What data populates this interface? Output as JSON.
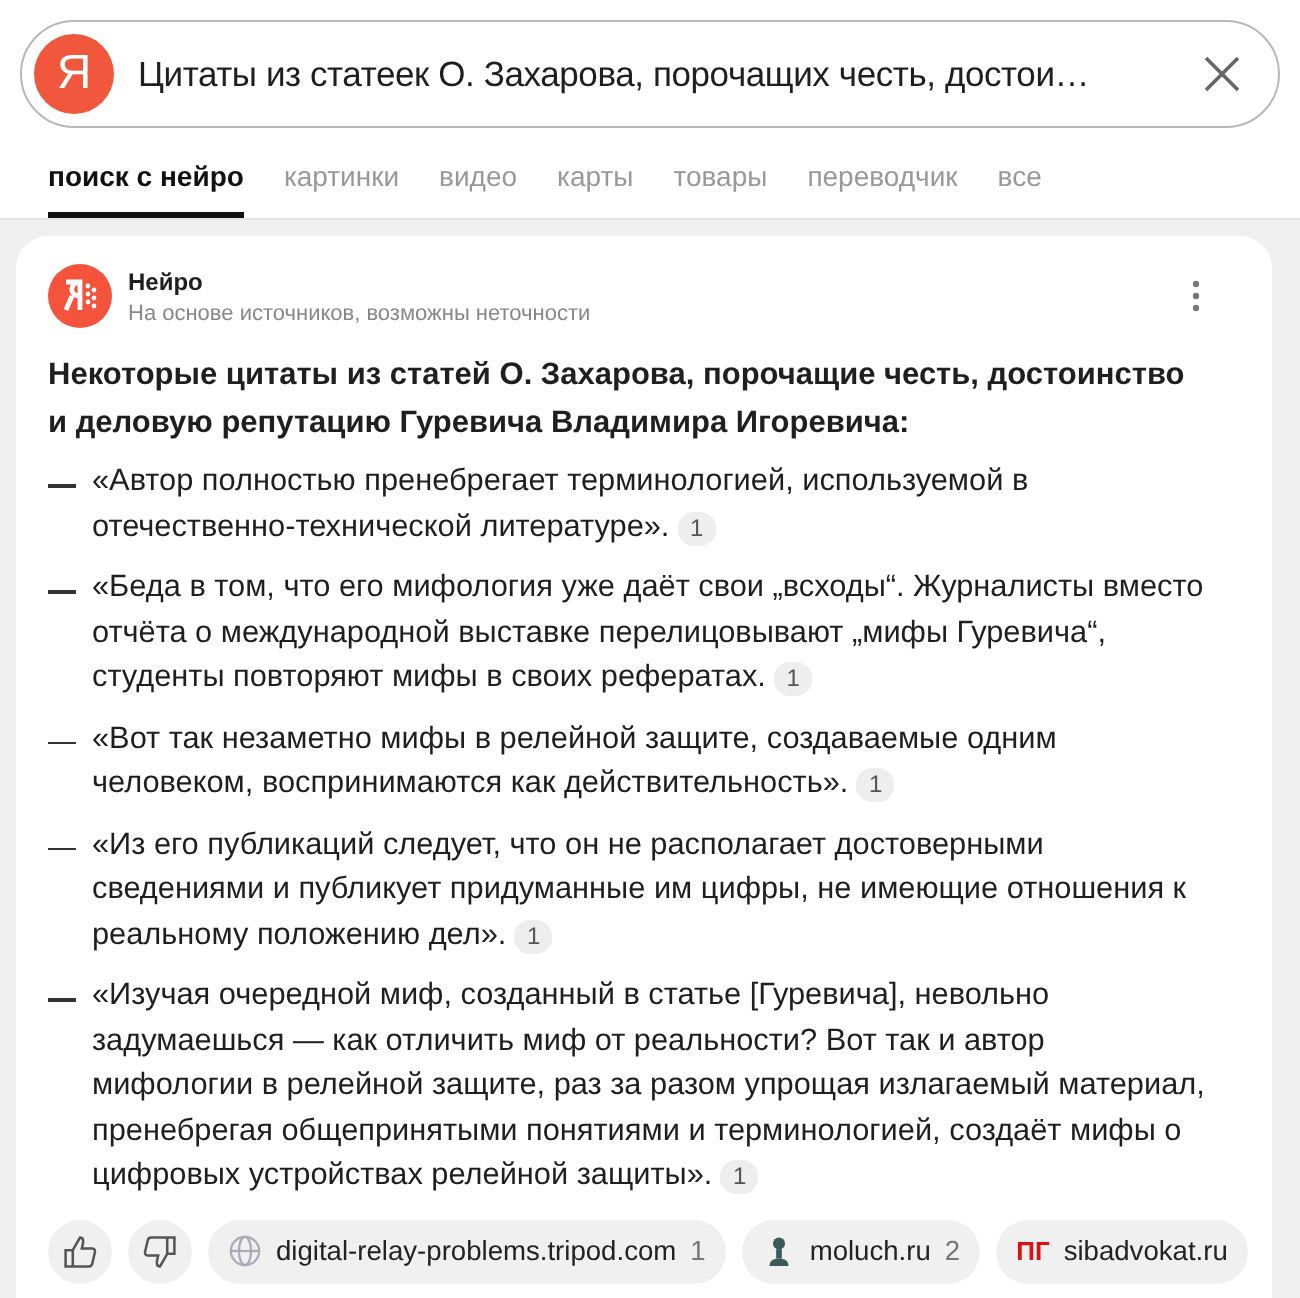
{
  "search": {
    "logo": "Я",
    "value": "Цитаты из статеек О. Захарова, порочащих честь, достои…"
  },
  "tabs": [
    {
      "label": "поиск с нейро",
      "selected": true
    },
    {
      "label": "картинки",
      "selected": false
    },
    {
      "label": "видео",
      "selected": false
    },
    {
      "label": "карты",
      "selected": false
    },
    {
      "label": "товары",
      "selected": false
    },
    {
      "label": "переводчик",
      "selected": false
    },
    {
      "label": "все",
      "selected": false
    }
  ],
  "answer": {
    "author": "Нейро",
    "subtitle": "На основе источников, возможны неточности",
    "heading": "Некоторые цитаты из статей О. Захарова, порочащие честь, достоинство и деловую репутацию Гуревича Владимира Игоревича:",
    "quotes": [
      {
        "text": "«Автор полностью пренебрегает терминологией, используемой в отечественно-технической литературе».",
        "ref": "1"
      },
      {
        "text": "«Беда в том, что его мифология уже даёт свои „всходы“. Журналисты вместо отчёта о международной выставке перелицовывают „мифы Гуревича“, студенты повторяют мифы в своих рефератах.",
        "ref": "1"
      },
      {
        "text": "«Вот так незаметно мифы в релейной защите, создаваемые одним человеком, воспринимаются как действительность».",
        "ref": "1"
      },
      {
        "text": "«Из его публикаций следует, что он не располагает достоверными сведениями и публикует придуманные им цифры, не имеющие отношения к реальному положению дел».",
        "ref": "1"
      },
      {
        "text": "«Изучая очередной миф, созданный в статье [Гуревича], невольно задумаешься — как отличить миф от реальности? Вот так и автор мифологии в релейной защите, раз за разом упрощая излагаемый материал, пренебрегая общепринятыми понятиями и терминологией, создаёт мифы о цифровых устройствах релейной защиты».",
        "ref": "1"
      }
    ],
    "sources": [
      {
        "kind": "globe",
        "name": "digital-relay-problems.tripod.com",
        "count": "1"
      },
      {
        "kind": "figure",
        "name": "moluch.ru",
        "count": "2"
      },
      {
        "kind": "letters",
        "mark": "ПГ",
        "name": "sibadvokat.ru"
      }
    ]
  }
}
